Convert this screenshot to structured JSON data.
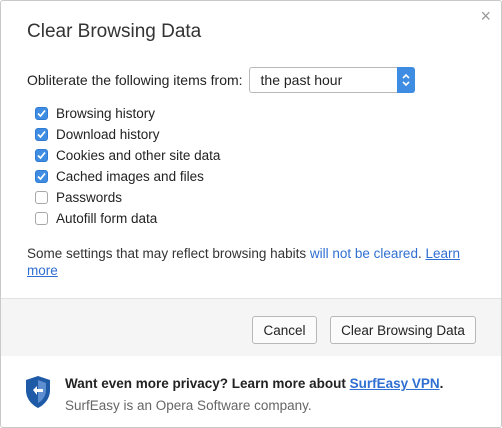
{
  "dialog": {
    "title": "Clear Browsing Data",
    "close_glyph": "×",
    "from_label": "Obliterate the following items from:",
    "time_range": {
      "selected": "the past hour"
    },
    "options": [
      {
        "label": "Browsing history",
        "checked": true
      },
      {
        "label": "Download history",
        "checked": true
      },
      {
        "label": "Cookies and other site data",
        "checked": true
      },
      {
        "label": "Cached images and files",
        "checked": true
      },
      {
        "label": "Passwords",
        "checked": false
      },
      {
        "label": "Autofill form data",
        "checked": false
      }
    ],
    "note": {
      "text": "Some settings that may reflect browsing habits ",
      "highlight": "will not be cleared",
      "after": ". ",
      "link": "Learn more"
    },
    "buttons": {
      "cancel": "Cancel",
      "clear": "Clear Browsing Data"
    },
    "promo": {
      "line1": "Want even more privacy? Learn more about ",
      "link": "SurfEasy VPN",
      "period": ".",
      "line2": "SurfEasy is an Opera Software company.",
      "icon": "shield-icon"
    },
    "colors": {
      "accent": "#3f8de3",
      "link": "#2f6fd1",
      "shield": "#1f5aa6"
    }
  }
}
